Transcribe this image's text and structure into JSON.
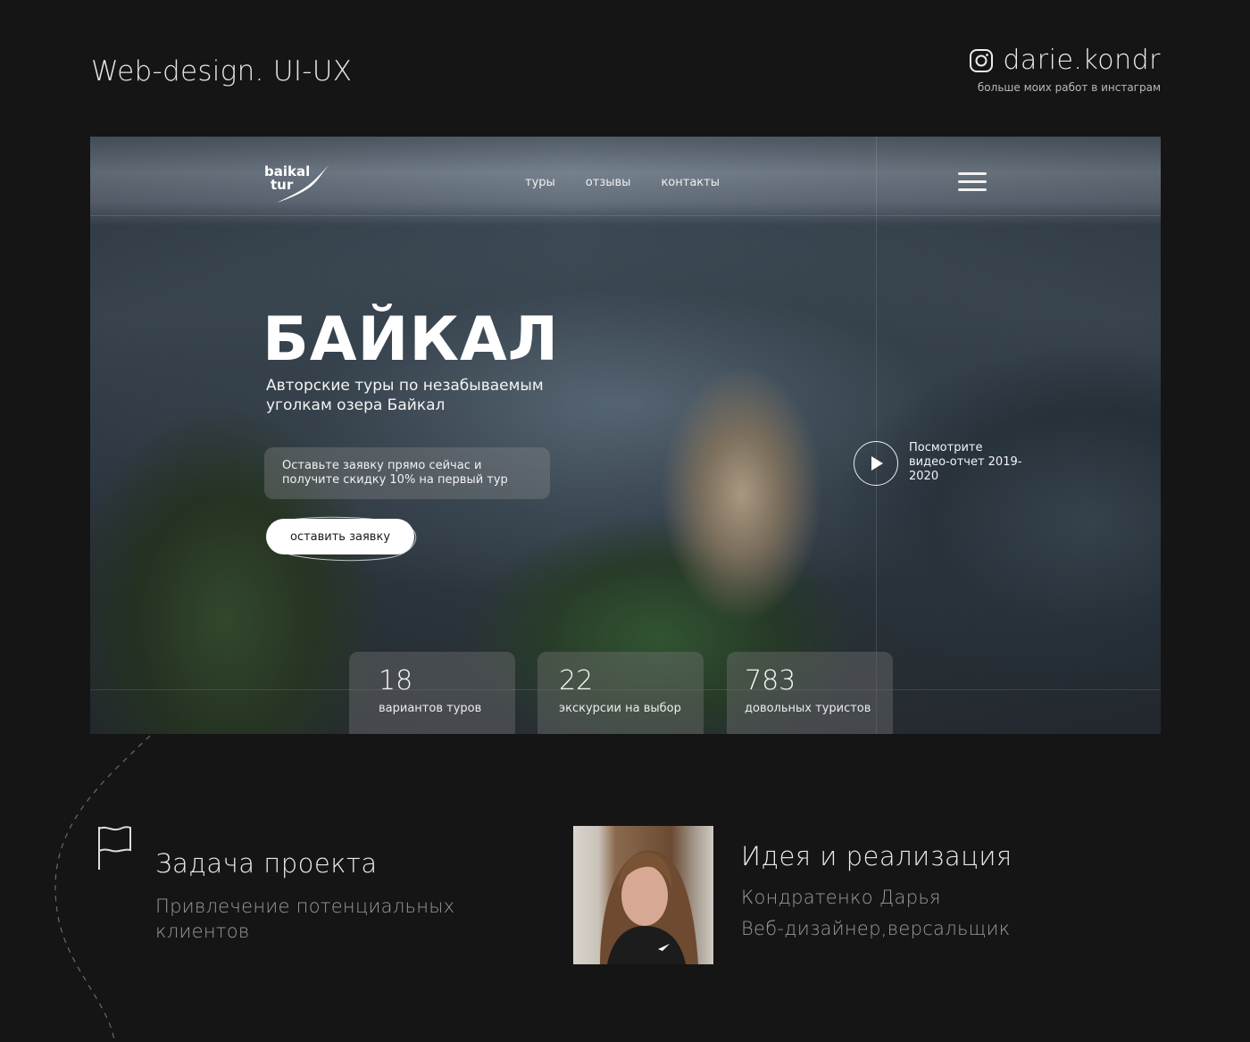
{
  "header": {
    "title": "Web-design. UI-UX",
    "instagram_handle": "darie.kondr",
    "instagram_caption": "больше моих работ в инстаграм"
  },
  "hero": {
    "logo_line1": "baikal",
    "logo_line2": "tur",
    "nav": [
      "туры",
      "отзывы",
      "контакты"
    ],
    "title": "БАЙКАЛ",
    "subtitle": "Авторские туры по незабываемым уголкам озера Байкал",
    "offer": "Оставьте заявку прямо сейчас и получите скидку 10% на первый тур",
    "cta_label": "оставить заявку",
    "video_label": "Посмотрите видео-отчет 2019-2020",
    "stats": [
      {
        "value": "18",
        "label": "вариантов туров"
      },
      {
        "value": "22",
        "label": "экскурсии на выбор"
      },
      {
        "value": "783",
        "label": "довольных туристов"
      }
    ]
  },
  "task": {
    "title": "Задача проекта",
    "description": "Привлечение потенциальных клиентов"
  },
  "idea": {
    "title": "Идея и реализация",
    "name": "Кондратенко Дарья",
    "role": "Веб-дизайнер,версальщик"
  },
  "colors": {
    "background": "#151515",
    "text_primary": "#e8e8e8",
    "text_secondary": "#9a9a9a",
    "cta_background": "#ffffff"
  }
}
